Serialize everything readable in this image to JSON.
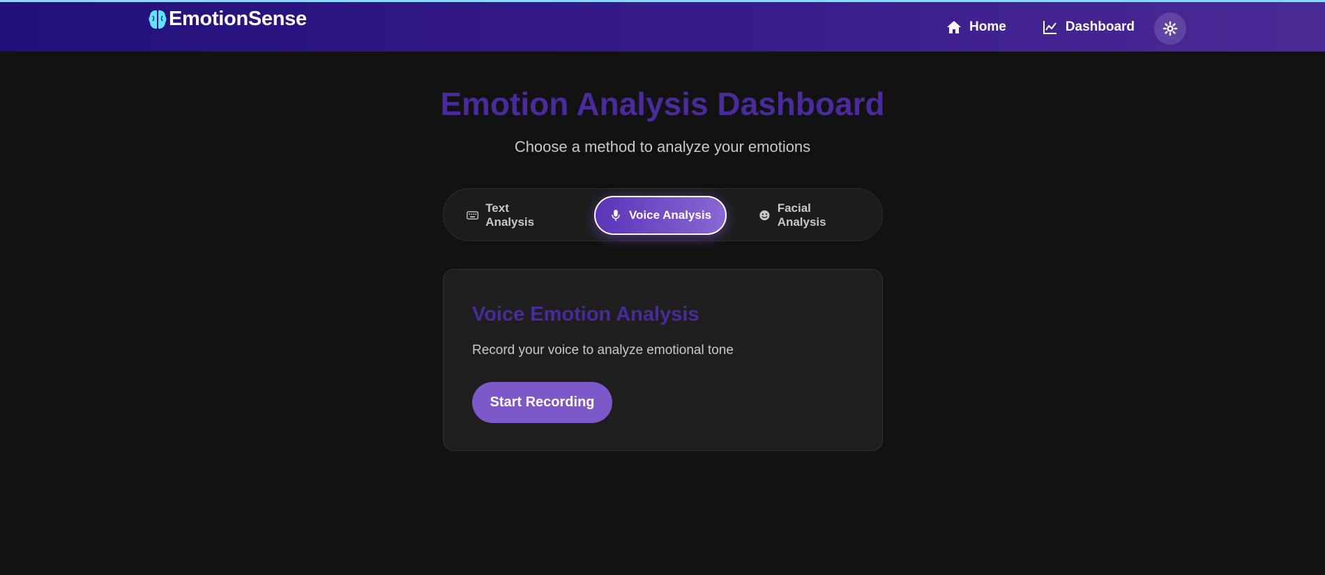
{
  "navbar": {
    "brand": "EmotionSense",
    "brand_icon": "brain-icon",
    "links": [
      {
        "label": "Home",
        "icon": "home-icon"
      },
      {
        "label": "Dashboard",
        "icon": "chart-line-icon"
      }
    ],
    "theme_toggle_icon": "sun-icon"
  },
  "header": {
    "title": "Emotion Analysis Dashboard",
    "subtitle": "Choose a method to analyze your emotions"
  },
  "tabs": [
    {
      "label": "Text Analysis",
      "icon": "keyboard-icon",
      "active": false
    },
    {
      "label": "Voice Analysis",
      "icon": "microphone-icon",
      "active": true
    },
    {
      "label": "Facial Analysis",
      "icon": "smile-icon",
      "active": false
    }
  ],
  "card": {
    "title": "Voice Emotion Analysis",
    "description": "Record your voice to analyze emotional tone",
    "button_label": "Start Recording"
  },
  "colors": {
    "accent": "#4b2a9b",
    "button": "#7c58c8",
    "background": "#121212",
    "brand_icon": "#5ee4ff"
  }
}
